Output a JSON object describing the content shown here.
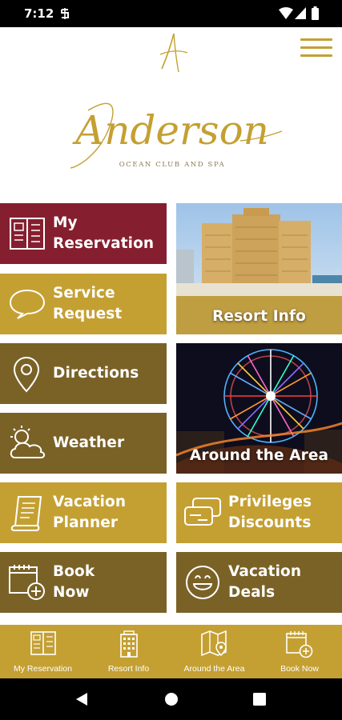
{
  "status_bar": {
    "time": "7:12"
  },
  "brand": {
    "name": "Anderson",
    "tagline": "OCEAN CLUB AND SPA"
  },
  "colors": {
    "gold": "#c4a033",
    "dark_gold": "#7a6227",
    "maroon": "#851f2f"
  },
  "tiles": {
    "my_reservation": "My\nReservation",
    "service_request": "Service\nRequest",
    "directions": "Directions",
    "weather": "Weather",
    "vacation_planner": "Vacation\nPlanner",
    "book_now": "Book\nNow",
    "resort_info": "Resort Info",
    "around_area": "Around the Area",
    "privileges": "Privileges\nDiscounts",
    "vacation_deals": "Vacation\nDeals"
  },
  "bottom_nav": {
    "my_reservation": "My Reservation",
    "resort_info": "Resort Info",
    "around_area": "Around the Area",
    "book_now": "Book Now"
  }
}
